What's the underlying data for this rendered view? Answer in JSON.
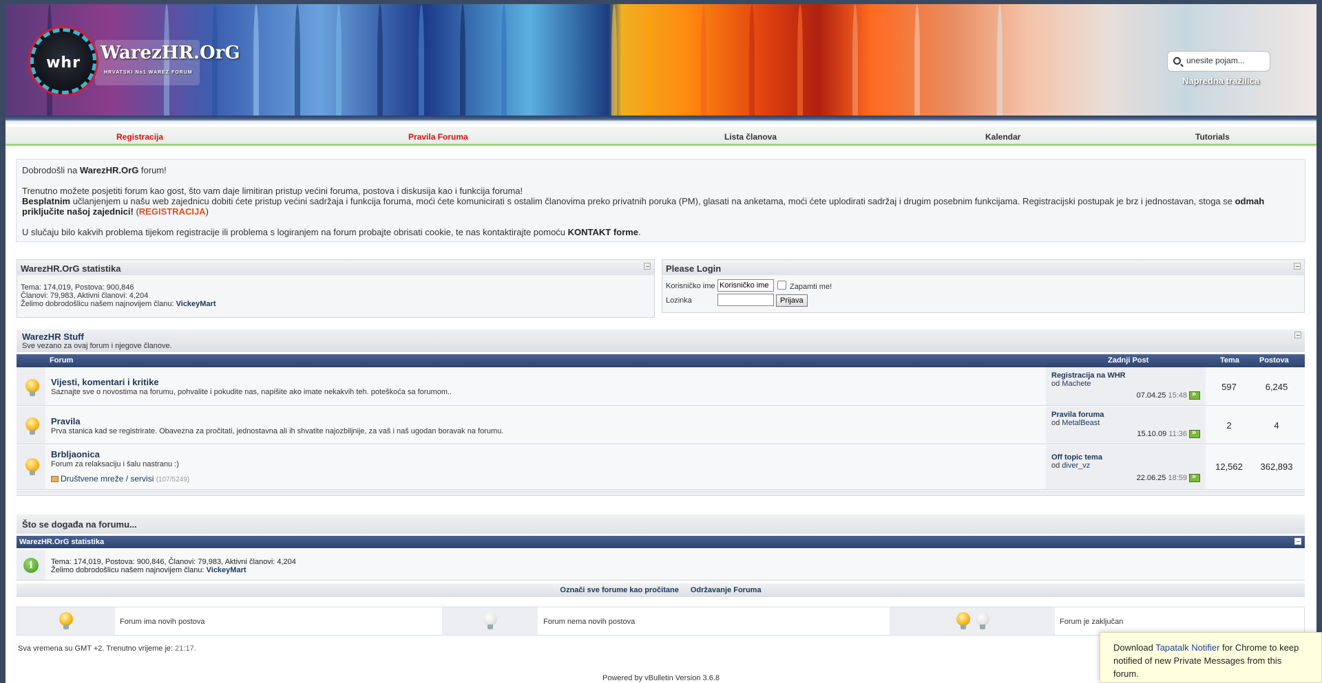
{
  "header": {
    "logo_mark": "whr",
    "logo_text": "WarezHR.OrG",
    "logo_sub": "HRVATSKI No1 WAREZ FORUM",
    "search_placeholder": "unesite pojam...",
    "advanced_search": "Napredna tražilica"
  },
  "nav": {
    "items": [
      {
        "label": "Registracija",
        "color": "#d21010"
      },
      {
        "label": "Pravila Foruma",
        "color": "#d21010"
      },
      {
        "label": "Lista članova",
        "color": "#333333"
      },
      {
        "label": "Kalendar",
        "color": "#333333"
      },
      {
        "label": "Tutorials",
        "color": "#333333"
      }
    ]
  },
  "welcome": {
    "line1_pre": "Dobrodošli na ",
    "line1_bold": "WarezHR.OrG",
    "line1_post": " forum!",
    "line2": "Trenutno možete posjetiti forum kao gost, što vam daje limitiran pristup većini foruma, postova i diskusija kao i funkcija foruma!",
    "line3_bold": "Besplatnim",
    "line3_mid": " učlanjenjem u našu web zajednicu dobiti ćete pristup većini sadržaja i funkcija foruma, moći ćete komunicirati s ostalim članovima preko privatnih poruka (PM), glasati na anketama, moći ćete uplodirati sadržaj i drugim posebnim funkcijama. Registracijski postupak je brz i jednostavan, stoga se ",
    "line3_bold2": "odmah priključite našoj zajednici!",
    "line3_paren_open": " (",
    "line3_reg": "REGISTRACIJA",
    "line3_paren_close": ")",
    "line4_pre": "U slučaju bilo kakvih problema tijekom registracije ili problema s logiranjem na forum probajte obrisati cookie, te nas kontaktirajte pomoću ",
    "line4_link": "KONTAKT forme",
    "line4_post": "."
  },
  "stats_panel": {
    "title": "WarezHR.OrG statistika",
    "line1": "Tema: 174,019, Postova: 900,846",
    "line2": "Članovi: 79,983, Aktivni članovi: 4,204",
    "line3_pre": "Želimo dobrodošlicu našem najnovijem članu: ",
    "line3_user": "VickeyMart"
  },
  "login_panel": {
    "title": "Please Login",
    "username_label": "Korisničko ime",
    "username_value": "Korisničko ime",
    "remember_label": "Zapamti me!",
    "password_label": "Lozinka",
    "login_button": "Prijava"
  },
  "forum_category": {
    "title": "WarezHR Stuff",
    "description": "Sve vezano za ovaj forum i njegove članove.",
    "columns": [
      "Forum",
      "Zadnji Post",
      "Tema",
      "Postova"
    ],
    "forums": [
      {
        "title": "Vijesti, komentari i kritike",
        "description": "Saznajte sve o novostima na forumu, pohvalite i pokudite nas, napišite ako imate nekakvih teh. poteškoća sa forumom..",
        "last_title": "Registracija na WHR",
        "last_by": "od ",
        "last_user": "Machete",
        "last_date": "07.04.25",
        "last_time": "15:48",
        "threads": "597",
        "posts": "6,245"
      },
      {
        "title": "Pravila",
        "description": "Prva stanica kad se registrirate. Obavezna za pročitati, jednostavna ali ih shvatite najozbiljnije, za vaš i naš ugodan boravak na forumu.",
        "last_title": "Pravila foruma",
        "last_by": "od ",
        "last_user": "MetalBeast",
        "last_date": "15.10.09",
        "last_time": "11:36",
        "threads": "2",
        "posts": "4"
      },
      {
        "title": "Brbljaonica",
        "description": "Forum za relaksaciju i šalu nastranu :)",
        "subforum": "Društvene mreže / servisi",
        "subforum_counts": "(107/5249)",
        "last_title": "Off topic tema",
        "last_by": "od ",
        "last_user": "diver_vz",
        "last_date": "22.06.25",
        "last_time": "18:59",
        "threads": "12,562",
        "posts": "362,893"
      }
    ]
  },
  "whats_going_on": {
    "title": "Što se događa na forumu...",
    "stats_title": "WarezHR.OrG statistika",
    "stats_line1": "Tema: 174,019, Postova: 900,846, Članovi: 79,983, Aktivni članovi: 4,204",
    "stats_line2_pre": "Želimo dobrodošlicu našem najnovijem članu: ",
    "stats_line2_user": "VickeyMart"
  },
  "actions": {
    "mark_read": "Označi sve forume kao pročitane",
    "maintenance": "Održavanje Foruma"
  },
  "legend": {
    "new_posts": "Forum ima novih postova",
    "no_new_posts": "Forum nema novih postova",
    "locked": "Forum je zaključan"
  },
  "footer": {
    "time_pre": "Sva vremena su GMT +2. Trenutno vrijeme je: ",
    "time_value": "21:17.",
    "powered": "Powered by vBulletin Version 3.6.8"
  },
  "toast": {
    "pre": "Download ",
    "link": "Tapatalk Notifier",
    "post": " for Chrome to keep notified of new Private Messages from this forum."
  }
}
